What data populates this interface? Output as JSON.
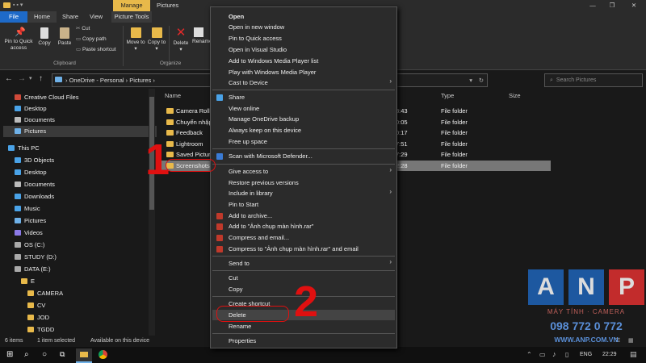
{
  "window": {
    "title": "Pictures",
    "contextual_tab": "Manage",
    "contextual_sub": "Picture Tools"
  },
  "tabs": [
    "File",
    "Home",
    "Share",
    "View"
  ],
  "ribbon": {
    "pin_quick": "Pin to Quick access",
    "copy": "Copy",
    "paste": "Paste",
    "cut": "Cut",
    "copy_path": "Copy path",
    "paste_shortcut": "Paste shortcut",
    "move_to": "Move to",
    "copy_to": "Copy to",
    "delete": "Delete",
    "rename": "Rename",
    "group_clipboard": "Clipboard",
    "group_organize": "Organize"
  },
  "address": {
    "path": [
      "OneDrive - Personal",
      "Pictures"
    ],
    "search_placeholder": "Search Pictures"
  },
  "nav": [
    {
      "label": "Creative Cloud Files",
      "color": "#d04a3a"
    },
    {
      "label": "Desktop",
      "color": "#4aa3e8"
    },
    {
      "label": "Documents",
      "color": "#bbbbbb"
    },
    {
      "label": "Pictures",
      "color": "#6fb1e8"
    },
    {
      "label": "This PC",
      "color": "#4aa3e8"
    },
    {
      "label": "3D Objects",
      "color": "#4aa3e8"
    },
    {
      "label": "Desktop",
      "color": "#4aa3e8"
    },
    {
      "label": "Documents",
      "color": "#bbbbbb"
    },
    {
      "label": "Downloads",
      "color": "#4aa3e8"
    },
    {
      "label": "Music",
      "color": "#4aa3e8"
    },
    {
      "label": "Pictures",
      "color": "#6fb1e8"
    },
    {
      "label": "Videos",
      "color": "#8c7ae8"
    },
    {
      "label": "OS (C:)",
      "color": "#aaaaaa"
    },
    {
      "label": "STUDY (D:)",
      "color": "#aaaaaa"
    },
    {
      "label": "DATA (E:)",
      "color": "#aaaaaa"
    },
    {
      "label": "E",
      "color": "#e8b94a"
    },
    {
      "label": "CAMERA",
      "color": "#e8b94a"
    },
    {
      "label": "CV",
      "color": "#e8b94a"
    },
    {
      "label": "JOD",
      "color": "#e8b94a"
    },
    {
      "label": "TGDD",
      "color": "#e8b94a"
    }
  ],
  "columns": {
    "name": "Name",
    "type": "Type",
    "size": "Size"
  },
  "files": [
    {
      "name": "Camera Roll",
      "time": "8:43",
      "type": "File folder"
    },
    {
      "name": "Chuyển nhập",
      "time": "0:05",
      "type": "File folder"
    },
    {
      "name": "Feedback",
      "time": "0:17",
      "type": "File folder"
    },
    {
      "name": "Lightroom",
      "time": "7:51",
      "type": "File folder"
    },
    {
      "name": "Saved Picture",
      "time": "7:29",
      "type": "File folder"
    },
    {
      "name": "Screenshots",
      "time": "2:28",
      "type": "File folder"
    }
  ],
  "menu": [
    {
      "label": "Open",
      "bold": true
    },
    {
      "label": "Open in new window"
    },
    {
      "label": "Pin to Quick access"
    },
    {
      "label": "Open in Visual Studio"
    },
    {
      "label": "Add to Windows Media Player list"
    },
    {
      "label": "Play with Windows Media Player"
    },
    {
      "label": "Cast to Device",
      "arrow": true
    },
    {
      "label": "Share",
      "icon": "#4aa3e8",
      "sep_before": true
    },
    {
      "label": "View online"
    },
    {
      "label": "Manage OneDrive backup"
    },
    {
      "label": "Always keep on this device"
    },
    {
      "label": "Free up space"
    },
    {
      "label": "Scan with Microsoft Defender...",
      "icon": "#3a7bd5",
      "sep_before": true
    },
    {
      "label": "Give access to",
      "arrow": true,
      "sep_before": true
    },
    {
      "label": "Restore previous versions"
    },
    {
      "label": "Include in library",
      "arrow": true
    },
    {
      "label": "Pin to Start"
    },
    {
      "label": "Add to archive...",
      "icon": "#c0392b"
    },
    {
      "label": "Add to \"Ảnh chụp màn hình.rar\"",
      "icon": "#c0392b"
    },
    {
      "label": "Compress and email...",
      "icon": "#c0392b"
    },
    {
      "label": "Compress to \"Ảnh chụp màn hình.rar\" and email",
      "icon": "#c0392b"
    },
    {
      "label": "Send to",
      "arrow": true,
      "sep_before": true
    },
    {
      "label": "Cut",
      "sep_before": true
    },
    {
      "label": "Copy"
    },
    {
      "label": "Create shortcut",
      "sep_before": true
    },
    {
      "label": "Delete",
      "hl": true
    },
    {
      "label": "Rename"
    },
    {
      "label": "Properties",
      "sep_before": true
    }
  ],
  "status": {
    "items": "6 items",
    "selected": "1 item selected",
    "available": "Available on this device"
  },
  "annotations": {
    "one": "1",
    "two": "2"
  },
  "logo": {
    "letters": [
      "A",
      "N",
      "P"
    ],
    "subtitle": "MÁY TÍNH · CAMERA",
    "phone": "098 772 0 772",
    "site": "WWW.ANP.COM.VN"
  },
  "taskbar": {
    "lang": "ENG",
    "time": "22:29"
  },
  "colors": {
    "accent": "#e8b94a",
    "annotation": "#e01010",
    "manage_tab": "#e8b94a"
  }
}
